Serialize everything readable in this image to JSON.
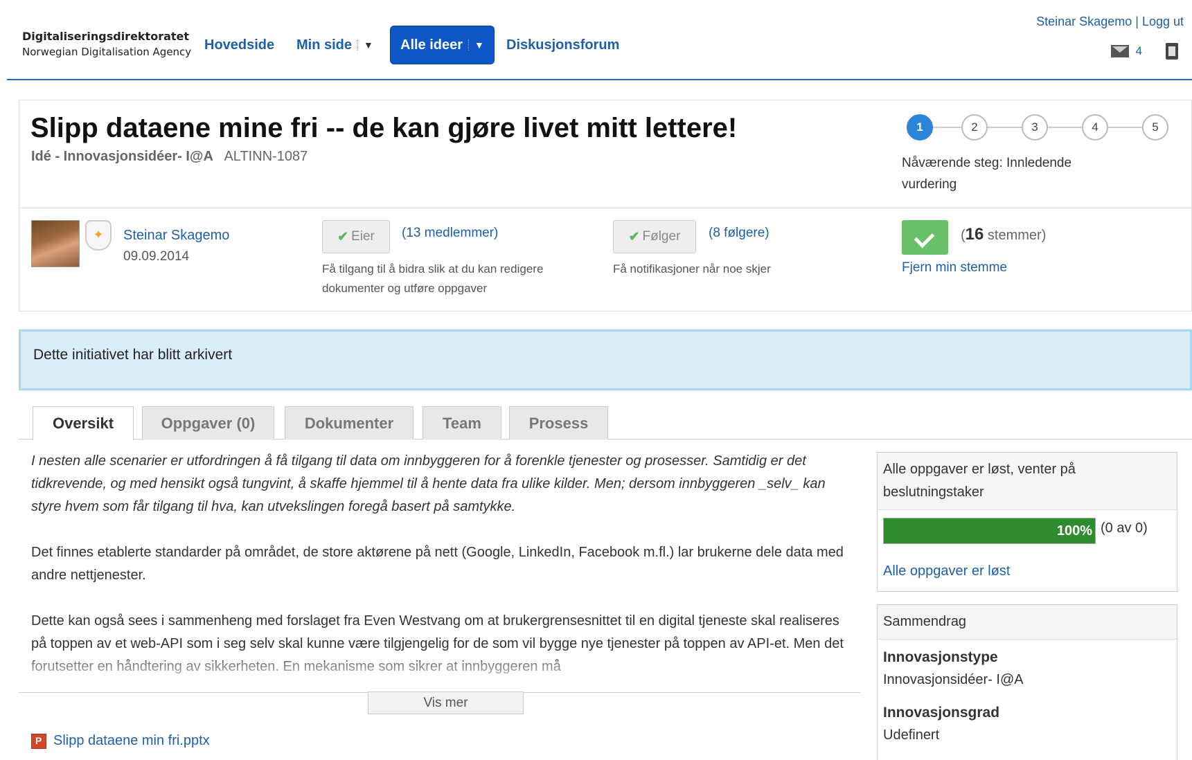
{
  "header": {
    "brand_line1": "Digitaliseringsdirektoratet",
    "brand_line2": "Norwegian Digitalisation Agency",
    "nav": [
      "Hovedside",
      "Min side",
      "Alle ideer",
      "Diskusjonsforum"
    ],
    "user_name": "Steinar Skagemo",
    "separator": "|",
    "logout": "Logg ut",
    "message_count": "4"
  },
  "idea": {
    "title": "Slipp dataene mine fri -- de kan gjøre livet mitt lettere!",
    "type_label": "Idé - Innovasjonsidéer- I@A",
    "id": "ALTINN-1087",
    "steps": [
      "1",
      "2",
      "3",
      "4",
      "5"
    ],
    "current_step_index": 0,
    "step_note": "Nåværende steg: Innledende vurdering"
  },
  "meta": {
    "author": "Steinar Skagemo",
    "date": "09.09.2014",
    "owner_button": "Eier",
    "members": "(13 medlemmer)",
    "owner_note": "Få tilgang til å bidra slik at du kan redigere dokumenter og utføre oppgaver",
    "follow_button": "Følger",
    "followers": "(8 følgere)",
    "follow_note": "Få notifikasjoner når noe skjer",
    "vote_prefix": "(",
    "vote_count": "16",
    "vote_suffix": " stemmer)",
    "remove_vote": "Fjern min stemme"
  },
  "alert": {
    "text": "Dette initiativet har blitt arkivert"
  },
  "tabs": [
    "Oversikt",
    "Oppgaver (0)",
    "Dokumenter",
    "Team",
    "Prosess"
  ],
  "content": {
    "intro": "I nesten alle scenarier er utfordringen å få tilgang til data om innbyggeren for å forenkle tjenester og prosesser. Samtidig er det tidkrevende, og med hensikt også tungvint, å skaffe hjemmel til å hente data fra ulike kilder. Men; dersom innbyggeren _selv_ kan styre hvem som får tilgang til hva, kan utvekslingen foregå basert på samtykke.",
    "paragraph2": "Det finnes etablerte standarder på området, de store aktørene på nett (Google, LinkedIn, Facebook m.fl.) lar brukerne dele data med andre nettjenester.",
    "paragraph3": "Dette kan også sees i sammenheng med forslaget fra Even Westvang om at brukergrensesnittet til en digital tjeneste skal realiseres på toppen av et web-API som i seg selv skal kunne være tilgjengelig for de som vil bygge nye tjenester på toppen av API-et. Men det forutsetter en håndtering av sikkerheten. En mekanisme som sikrer at innbyggeren må",
    "show_more": "Vis mer",
    "attachment": "Slipp dataene min fri.pptx"
  },
  "sidebar": {
    "tasks_header": "Alle oppgaver er løst, venter på beslutningstaker",
    "progress_percent": 100,
    "progress_label": "100%",
    "progress_count": "(0 av 0)",
    "tasks_link": "Alle oppgaver er løst",
    "summary_header": "Sammendrag",
    "innovation_type_label": "Innovasjonstype",
    "innovation_type_value": "Innovasjonsidéer- I@A",
    "innovation_degree_label": "Innovasjonsgrad",
    "innovation_degree_value": "Udefinert"
  },
  "colors": {
    "link": "#1f5fa8",
    "nav_active": "#0d56c5",
    "alert_bg": "#d9edf7",
    "progress": "#2e8c2e",
    "vote": "#6abf69"
  }
}
